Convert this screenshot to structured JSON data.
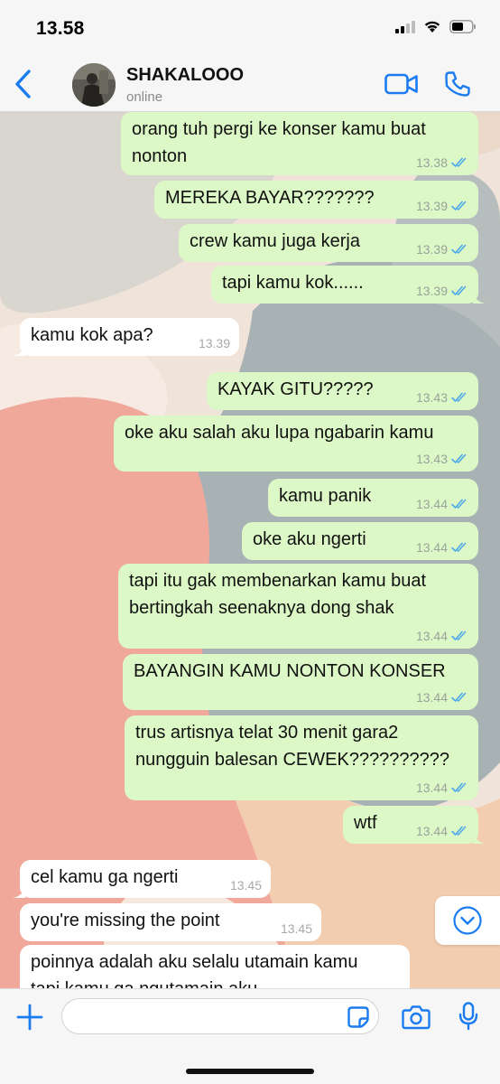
{
  "status_bar": {
    "time": "13.58",
    "icons": [
      "signal-icon",
      "wifi-icon",
      "battery-icon"
    ]
  },
  "header": {
    "contact_name": "SHAKALOOO",
    "contact_status": "online",
    "icons": [
      "back-chevron-icon",
      "video-call-icon",
      "phone-call-icon"
    ],
    "accent_color": "#1a7cf0"
  },
  "messages": [
    {
      "direction": "out",
      "text": "orang tuh pergi ke konser kamu buat\nnonton",
      "time": "13.38",
      "status": "read"
    },
    {
      "direction": "out",
      "text": "MEREKA BAYAR???????",
      "time": "13.39",
      "status": "read"
    },
    {
      "direction": "out",
      "text": "crew kamu juga kerja",
      "time": "13.39",
      "status": "read"
    },
    {
      "direction": "out",
      "text": "tapi kamu kok......",
      "time": "13.39",
      "status": "read"
    },
    {
      "direction": "in",
      "text": "kamu kok apa?",
      "time": "13.39"
    },
    {
      "direction": "out",
      "text": "KAYAK GITU?????",
      "time": "13.43",
      "status": "read"
    },
    {
      "direction": "out",
      "text": "oke aku salah aku lupa ngabarin kamu",
      "time": "13.43",
      "status": "read"
    },
    {
      "direction": "out",
      "text": "kamu panik",
      "time": "13.44",
      "status": "read"
    },
    {
      "direction": "out",
      "text": "oke aku ngerti",
      "time": "13.44",
      "status": "read"
    },
    {
      "direction": "out",
      "text": "tapi itu gak membenarkan kamu buat\nbertingkah seenaknya dong shak",
      "time": "13.44",
      "status": "read"
    },
    {
      "direction": "out",
      "text": "BAYANGIN KAMU NONTON KONSER",
      "time": "13.44",
      "status": "read"
    },
    {
      "direction": "out",
      "text": "trus artisnya telat 30 menit gara2\nnungguin balesan CEWEK??????????",
      "time": "13.44",
      "status": "read"
    },
    {
      "direction": "out",
      "text": "wtf",
      "time": "13.44",
      "status": "read"
    },
    {
      "direction": "in",
      "text": "cel kamu ga ngerti",
      "time": "13.45"
    },
    {
      "direction": "in",
      "text": "you're missing the point",
      "time": "13.45"
    },
    {
      "direction": "in",
      "text": "poinnya adalah aku selalu utamain kamu\ntapi kamu ga ngutamain aku",
      "time": ""
    }
  ],
  "colors": {
    "outgoing_bubble": "#dcf8c6",
    "incoming_bubble": "#ffffff",
    "read_tick": "#4fa8e8"
  },
  "input_bar": {
    "placeholder": "",
    "value": "",
    "icons": [
      "plus-icon",
      "sticker-icon",
      "camera-icon",
      "microphone-icon"
    ]
  },
  "scroll_button": {
    "icon": "chevron-down-circle-icon"
  }
}
